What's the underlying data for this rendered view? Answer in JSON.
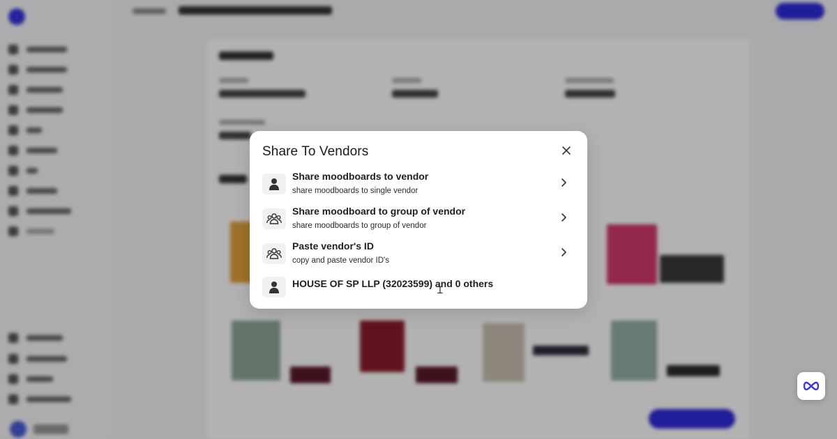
{
  "modal": {
    "title": "Share To Vendors",
    "options": [
      {
        "title": "Share moodboards to vendor",
        "subtitle": "share moodboards to single vendor",
        "icon": "person-icon"
      },
      {
        "title": "Share moodboard to group of vendor",
        "subtitle": "share moodboards to group of vendor",
        "icon": "group-icon"
      },
      {
        "title": "Paste vendor's ID",
        "subtitle": "copy and paste vendor ID's",
        "icon": "group-icon"
      }
    ],
    "selected_vendor": "HOUSE OF SP LLP (32023599) and 0 others"
  },
  "colors": {
    "accent": "#2f2bdb",
    "overlay": "rgba(0,0,0,0.30)",
    "icon_bg": "#f1f1f3"
  }
}
